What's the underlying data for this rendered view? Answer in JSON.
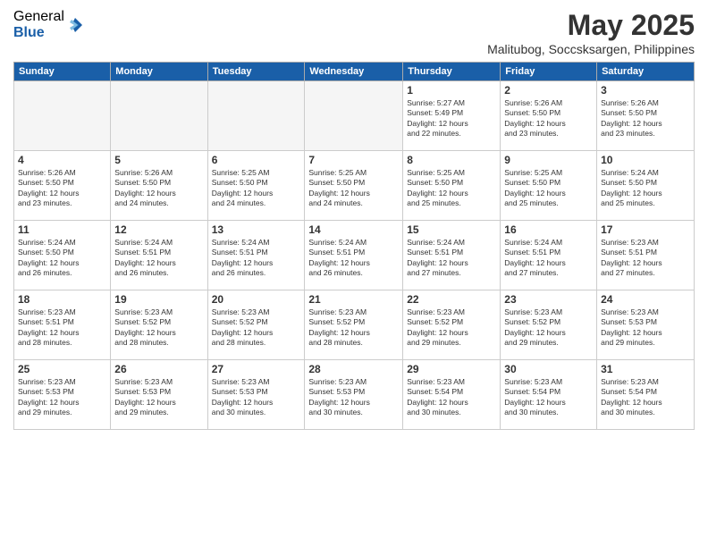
{
  "header": {
    "logo_general": "General",
    "logo_blue": "Blue",
    "month_title": "May 2025",
    "location": "Malitubog, Soccsksargen, Philippines"
  },
  "weekdays": [
    "Sunday",
    "Monday",
    "Tuesday",
    "Wednesday",
    "Thursday",
    "Friday",
    "Saturday"
  ],
  "weeks": [
    [
      {
        "day": "",
        "info": ""
      },
      {
        "day": "",
        "info": ""
      },
      {
        "day": "",
        "info": ""
      },
      {
        "day": "",
        "info": ""
      },
      {
        "day": "1",
        "info": "Sunrise: 5:27 AM\nSunset: 5:49 PM\nDaylight: 12 hours\nand 22 minutes."
      },
      {
        "day": "2",
        "info": "Sunrise: 5:26 AM\nSunset: 5:50 PM\nDaylight: 12 hours\nand 23 minutes."
      },
      {
        "day": "3",
        "info": "Sunrise: 5:26 AM\nSunset: 5:50 PM\nDaylight: 12 hours\nand 23 minutes."
      }
    ],
    [
      {
        "day": "4",
        "info": "Sunrise: 5:26 AM\nSunset: 5:50 PM\nDaylight: 12 hours\nand 23 minutes."
      },
      {
        "day": "5",
        "info": "Sunrise: 5:26 AM\nSunset: 5:50 PM\nDaylight: 12 hours\nand 24 minutes."
      },
      {
        "day": "6",
        "info": "Sunrise: 5:25 AM\nSunset: 5:50 PM\nDaylight: 12 hours\nand 24 minutes."
      },
      {
        "day": "7",
        "info": "Sunrise: 5:25 AM\nSunset: 5:50 PM\nDaylight: 12 hours\nand 24 minutes."
      },
      {
        "day": "8",
        "info": "Sunrise: 5:25 AM\nSunset: 5:50 PM\nDaylight: 12 hours\nand 25 minutes."
      },
      {
        "day": "9",
        "info": "Sunrise: 5:25 AM\nSunset: 5:50 PM\nDaylight: 12 hours\nand 25 minutes."
      },
      {
        "day": "10",
        "info": "Sunrise: 5:24 AM\nSunset: 5:50 PM\nDaylight: 12 hours\nand 25 minutes."
      }
    ],
    [
      {
        "day": "11",
        "info": "Sunrise: 5:24 AM\nSunset: 5:50 PM\nDaylight: 12 hours\nand 26 minutes."
      },
      {
        "day": "12",
        "info": "Sunrise: 5:24 AM\nSunset: 5:51 PM\nDaylight: 12 hours\nand 26 minutes."
      },
      {
        "day": "13",
        "info": "Sunrise: 5:24 AM\nSunset: 5:51 PM\nDaylight: 12 hours\nand 26 minutes."
      },
      {
        "day": "14",
        "info": "Sunrise: 5:24 AM\nSunset: 5:51 PM\nDaylight: 12 hours\nand 26 minutes."
      },
      {
        "day": "15",
        "info": "Sunrise: 5:24 AM\nSunset: 5:51 PM\nDaylight: 12 hours\nand 27 minutes."
      },
      {
        "day": "16",
        "info": "Sunrise: 5:24 AM\nSunset: 5:51 PM\nDaylight: 12 hours\nand 27 minutes."
      },
      {
        "day": "17",
        "info": "Sunrise: 5:23 AM\nSunset: 5:51 PM\nDaylight: 12 hours\nand 27 minutes."
      }
    ],
    [
      {
        "day": "18",
        "info": "Sunrise: 5:23 AM\nSunset: 5:51 PM\nDaylight: 12 hours\nand 28 minutes."
      },
      {
        "day": "19",
        "info": "Sunrise: 5:23 AM\nSunset: 5:52 PM\nDaylight: 12 hours\nand 28 minutes."
      },
      {
        "day": "20",
        "info": "Sunrise: 5:23 AM\nSunset: 5:52 PM\nDaylight: 12 hours\nand 28 minutes."
      },
      {
        "day": "21",
        "info": "Sunrise: 5:23 AM\nSunset: 5:52 PM\nDaylight: 12 hours\nand 28 minutes."
      },
      {
        "day": "22",
        "info": "Sunrise: 5:23 AM\nSunset: 5:52 PM\nDaylight: 12 hours\nand 29 minutes."
      },
      {
        "day": "23",
        "info": "Sunrise: 5:23 AM\nSunset: 5:52 PM\nDaylight: 12 hours\nand 29 minutes."
      },
      {
        "day": "24",
        "info": "Sunrise: 5:23 AM\nSunset: 5:53 PM\nDaylight: 12 hours\nand 29 minutes."
      }
    ],
    [
      {
        "day": "25",
        "info": "Sunrise: 5:23 AM\nSunset: 5:53 PM\nDaylight: 12 hours\nand 29 minutes."
      },
      {
        "day": "26",
        "info": "Sunrise: 5:23 AM\nSunset: 5:53 PM\nDaylight: 12 hours\nand 29 minutes."
      },
      {
        "day": "27",
        "info": "Sunrise: 5:23 AM\nSunset: 5:53 PM\nDaylight: 12 hours\nand 30 minutes."
      },
      {
        "day": "28",
        "info": "Sunrise: 5:23 AM\nSunset: 5:53 PM\nDaylight: 12 hours\nand 30 minutes."
      },
      {
        "day": "29",
        "info": "Sunrise: 5:23 AM\nSunset: 5:54 PM\nDaylight: 12 hours\nand 30 minutes."
      },
      {
        "day": "30",
        "info": "Sunrise: 5:23 AM\nSunset: 5:54 PM\nDaylight: 12 hours\nand 30 minutes."
      },
      {
        "day": "31",
        "info": "Sunrise: 5:23 AM\nSunset: 5:54 PM\nDaylight: 12 hours\nand 30 minutes."
      }
    ]
  ]
}
